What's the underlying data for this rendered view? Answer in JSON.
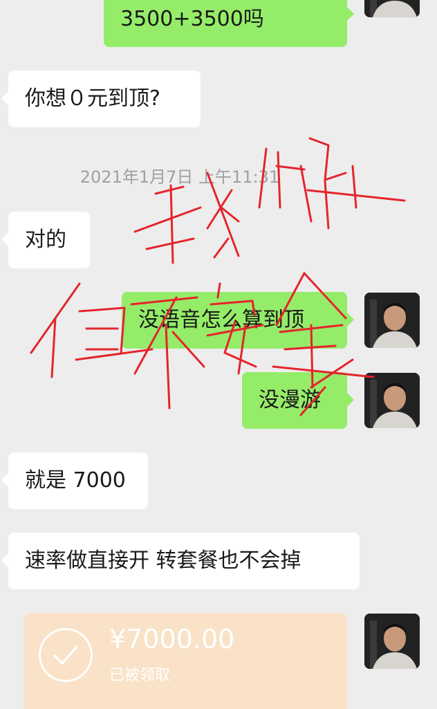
{
  "messages": [
    {
      "side": "right",
      "text": "3500+3500吗"
    },
    {
      "side": "left",
      "text": "你想０元到顶?"
    },
    {
      "side": "left",
      "text": "对的"
    },
    {
      "side": "right",
      "text": "没语音怎么算到顶"
    },
    {
      "side": "right",
      "text": "没漫游"
    },
    {
      "side": "left",
      "text": "就是 7000"
    },
    {
      "side": "left",
      "text": "速率做直接开 转套餐也不会掉"
    }
  ],
  "timestamp": "2021年1月7日 上午11:31",
  "transfer": {
    "amount": "¥7000.00",
    "status": "已被领取"
  },
  "colors": {
    "background": "#ededed",
    "bubble_left": "#ffffff",
    "bubble_right": "#95ec69",
    "transfer_card": "#f9e2c7",
    "annotation_ink": "#e5242b"
  },
  "annotation": {
    "characters": [
      "我",
      "很",
      "快",
      "但",
      "不",
      "安",
      "全"
    ]
  }
}
